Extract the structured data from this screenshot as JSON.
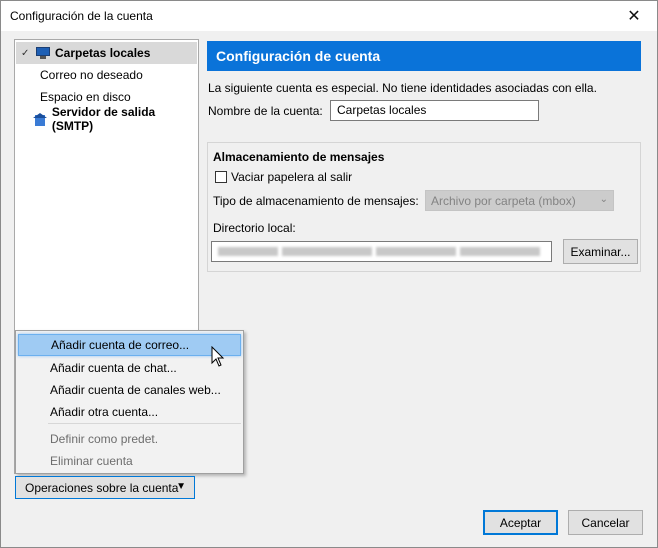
{
  "window": {
    "title": "Configuración de la cuenta",
    "close_glyph": "✕"
  },
  "tree": {
    "items": [
      {
        "label": "Carpetas locales",
        "icon": "computer-icon",
        "selected": true,
        "expanded": true
      },
      {
        "label": "Correo no deseado"
      },
      {
        "label": "Espacio en disco"
      },
      {
        "label": "Servidor de salida (SMTP)",
        "icon": "server-icon"
      }
    ]
  },
  "header": {
    "title": "Configuración de cuenta",
    "color": "#0a73d9"
  },
  "account": {
    "notice": "La siguiente cuenta es especial. No tiene identidades asociadas con ella.",
    "name_label": "Nombre de la cuenta:",
    "name_value": "Carpetas locales"
  },
  "storage": {
    "group_title": "Almacenamiento de mensajes",
    "empty_trash_label": "Vaciar papelera al salir",
    "empty_trash_checked": false,
    "store_type_label": "Tipo de almacenamiento de mensajes:",
    "store_type_value": "Archivo por carpeta (mbox)",
    "local_dir_label": "Directorio local:",
    "browse_label": "Examinar..."
  },
  "menu": {
    "items": [
      {
        "label": "Añadir cuenta de correo...",
        "enabled": true,
        "highlighted": true
      },
      {
        "label": "Añadir cuenta de chat...",
        "enabled": true
      },
      {
        "label": "Añadir cuenta de canales web...",
        "enabled": true
      },
      {
        "label": "Añadir otra cuenta...",
        "enabled": true
      },
      {
        "label": "Definir como predet.",
        "enabled": false
      },
      {
        "label": "Eliminar cuenta",
        "enabled": false
      }
    ]
  },
  "account_ops_label": "Operaciones sobre la cuenta",
  "footer": {
    "accept_label": "Aceptar",
    "cancel_label": "Cancelar"
  }
}
